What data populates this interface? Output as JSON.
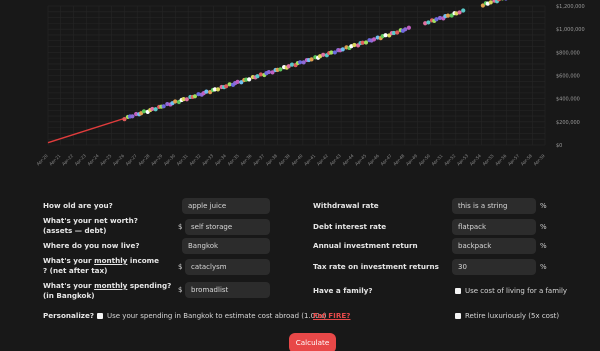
{
  "chart_data": {
    "type": "scatter",
    "y_ticks": [
      "$0",
      "$200,000",
      "$400,000",
      "$600,000",
      "$800,000",
      "$1,000,000",
      "$1,200,000"
    ],
    "ylim": [
      0,
      1200000
    ],
    "x_ticks": [
      "Apr-20",
      "Apr-21",
      "Apr-22",
      "Apr-23",
      "Apr-24",
      "Apr-25",
      "Apr-26",
      "Apr-27",
      "Apr-28",
      "Apr-29",
      "Apr-30",
      "Apr-31",
      "Apr-32",
      "Apr-33",
      "Apr-34",
      "Apr-35",
      "Apr-36",
      "Apr-37",
      "Apr-38",
      "Apr-39",
      "Apr-40",
      "Apr-41",
      "Apr-42",
      "Apr-43",
      "Apr-44",
      "Apr-45",
      "Apr-46",
      "Apr-47",
      "Apr-48",
      "Apr-49",
      "Apr-50",
      "Apr-51",
      "Apr-52",
      "Apr-53",
      "Apr-54",
      "Apr-55",
      "Apr-56",
      "Apr-57",
      "Apr-58",
      "Apr-59"
    ],
    "series": [
      {
        "type": "line",
        "color": "#e03c3c",
        "x_range": [
          "Apr-20",
          "Apr-26"
        ],
        "y_range": [
          20000,
          230000
        ]
      },
      {
        "type": "scatter",
        "x_range": [
          "Apr-26",
          "Apr-57"
        ],
        "y_range": [
          230000,
          1310000
        ]
      }
    ],
    "grid": true
  },
  "form": {
    "age_label": "How old are you?",
    "age_value": "apple juice",
    "networth_label_1": "What's your net worth?",
    "networth_label_2": "(assets — debt)",
    "networth_symbol": "$",
    "networth_value": "self storage",
    "live_label": "Where do you now live?",
    "live_value": "Bangkok",
    "income_label_pre": "What's your ",
    "income_label_u": "monthly",
    "income_label_post": " income",
    "income_label_2": "? (net after tax)",
    "income_symbol": "$",
    "income_value": "cataclysm",
    "spend_label_pre": "What's your ",
    "spend_label_u": "monthly",
    "spend_label_post": " spending?",
    "spend_label_2": "(in Bangkok)",
    "spend_symbol": "$",
    "spend_value": "bromadlist",
    "withdrawal_label": "Withdrawal rate",
    "withdrawal_value": "this is a string",
    "withdrawal_unit": "%",
    "debt_label": "Debt interest rate",
    "debt_value": "flatpack",
    "debt_unit": "%",
    "return_label": "Annual investment return",
    "return_value": "backpack",
    "return_unit": "%",
    "tax_label": "Tax rate on investment returns",
    "tax_value": "30",
    "tax_unit": "%",
    "family_label": "Have a family?",
    "family_option": "Use cost of living for a family",
    "personalize_label": "Personalize?",
    "personalize_option": "Use your spending in Bangkok to estimate cost abroad (1.00x)",
    "fatfire_link": "Fat FIRE?",
    "retire_option": "Retire luxuriously (5x cost)",
    "calculate_label": "Calculate"
  }
}
